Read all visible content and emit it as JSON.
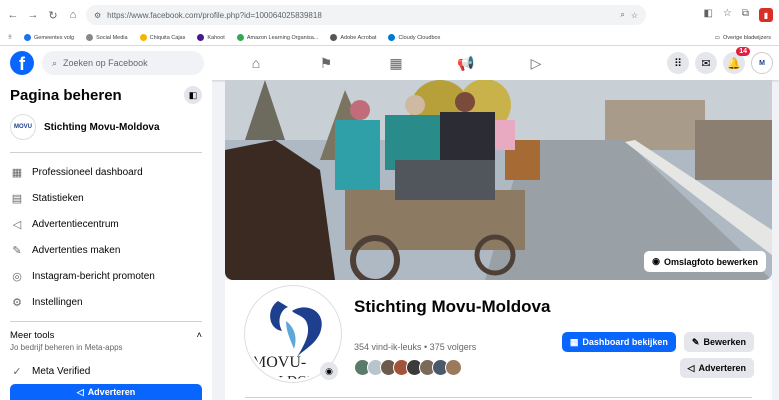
{
  "browser": {
    "url": "https://www.facebook.com/profile.php?id=100064025839818",
    "bookmarks": [
      "Gemeentes volg",
      "Social Media",
      "Chiquita Cajas",
      "Kahoot",
      "Amazon Learning Organisa...",
      "Adobe Acrobat",
      "Cloudy Cloudbox"
    ],
    "bookmarks_right": "Overige bladwijzers"
  },
  "topnav": {
    "search_placeholder": "Zoeken op Facebook",
    "notification_count": "14"
  },
  "sidebar": {
    "title": "Pagina beheren",
    "page_name": "Stichting Movu-Moldova",
    "items": [
      {
        "label": "Professioneel dashboard",
        "icon": "dashboard-icon"
      },
      {
        "label": "Statistieken",
        "icon": "stats-icon"
      },
      {
        "label": "Advertentiecentrum",
        "icon": "megaphone-icon"
      },
      {
        "label": "Advertenties maken",
        "icon": "pencil-icon"
      },
      {
        "label": "Instagram-bericht promoten",
        "icon": "instagram-icon"
      },
      {
        "label": "Instellingen",
        "icon": "gear-icon"
      }
    ],
    "more_tools_title": "Meer tools",
    "more_tools_sub": "Jo bedrijf beheren in Meta-apps",
    "meta_verified": "Meta Verified",
    "advertise_label": "Adverteren"
  },
  "cover": {
    "edit_label": "Omslagfoto bewerken"
  },
  "profile": {
    "name": "Stichting Movu-Moldova",
    "stats": "354 vind-ik-leuks • 375 volgers",
    "logo_text_line1": "MOVU-",
    "logo_text_line2": "MOLDOVA",
    "dashboard_label": "Dashboard bekijken",
    "edit_label": "Bewerken",
    "advertise_label": "Adverteren"
  },
  "colors": {
    "fb_blue": "#0866ff",
    "logo_blue": "#1d3f8e"
  }
}
